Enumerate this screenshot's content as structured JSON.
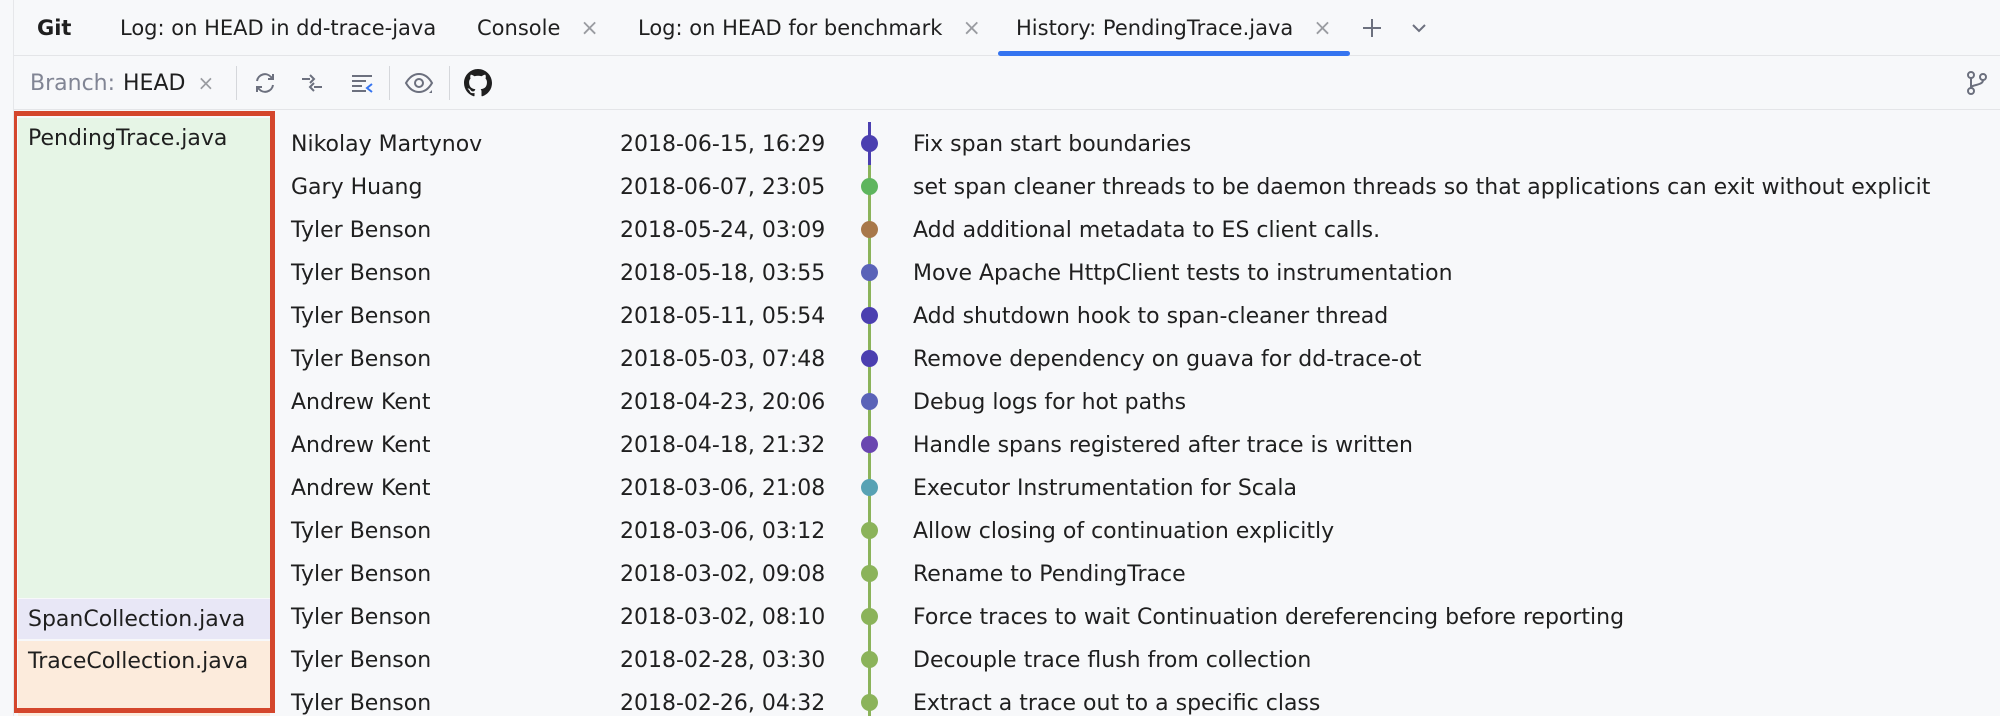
{
  "tabs": [
    {
      "label": "Git",
      "bold": true,
      "closable": false,
      "active": false
    },
    {
      "label": "Log: on HEAD in dd-trace-java",
      "closable": false,
      "active": false
    },
    {
      "label": "Console",
      "closable": true,
      "active": false
    },
    {
      "label": "Log: on HEAD for benchmark",
      "closable": true,
      "active": false
    },
    {
      "label": "History: PendingTrace.java",
      "closable": true,
      "active": true
    }
  ],
  "tab_close_glyph": "×",
  "toolbar": {
    "branch_label": "Branch:",
    "branch_value": "HEAD",
    "icons": [
      "refresh-icon",
      "collapse-icon",
      "align-icon",
      "eye-icon",
      "github-icon",
      "branch-icon"
    ]
  },
  "colors": {
    "accent": "#3574f0",
    "highlight_border": "#d4462c",
    "file_pending_bg": "#e6f5e6",
    "file_span_bg": "#e8e7f6",
    "file_trace_bg": "#fcebdc"
  },
  "files": {
    "pending": "PendingTrace.java",
    "span": "SpanCollection.java",
    "trace": "TraceCollection.java"
  },
  "commits": [
    {
      "author": "Nikolay Martynov",
      "date": "2018-06-15, 16:29",
      "message": "Fix span start boundaries",
      "dot_color": "#4b3fb0"
    },
    {
      "author": "Gary Huang",
      "date": "2018-06-07, 23:05",
      "message": "set span cleaner threads to be daemon threads so that applications can exit without explicit",
      "dot_color": "#5eb55e"
    },
    {
      "author": "Tyler Benson",
      "date": "2018-05-24, 03:09",
      "message": "Add additional metadata to ES client calls.",
      "dot_color": "#a8784a"
    },
    {
      "author": "Tyler Benson",
      "date": "2018-05-18, 03:55",
      "message": "Move Apache HttpClient tests to instrumentation",
      "dot_color": "#5a63b8"
    },
    {
      "author": "Tyler Benson",
      "date": "2018-05-11, 05:54",
      "message": "Add shutdown hook to span-cleaner thread",
      "dot_color": "#4b3fb0"
    },
    {
      "author": "Tyler Benson",
      "date": "2018-05-03, 07:48",
      "message": "Remove dependency on guava for dd-trace-ot",
      "dot_color": "#4b3fb0"
    },
    {
      "author": "Andrew Kent",
      "date": "2018-04-23, 20:06",
      "message": "Debug logs for hot paths",
      "dot_color": "#5a63b8"
    },
    {
      "author": "Andrew Kent",
      "date": "2018-04-18, 21:32",
      "message": "Handle spans registered after trace is written",
      "dot_color": "#6a46b0"
    },
    {
      "author": "Andrew Kent",
      "date": "2018-03-06, 21:08",
      "message": "Executor Instrumentation for Scala",
      "dot_color": "#58a2b4"
    },
    {
      "author": "Tyler Benson",
      "date": "2018-03-06, 03:12",
      "message": "Allow closing of continuation explicitly",
      "dot_color": "#8bb35a"
    },
    {
      "author": "Tyler Benson",
      "date": "2018-03-02, 09:08",
      "message": "Rename to PendingTrace",
      "dot_color": "#8bb35a"
    },
    {
      "author": "Tyler Benson",
      "date": "2018-03-02, 08:10",
      "message": "Force traces to wait Continuation dereferencing before reporting",
      "dot_color": "#8bb35a"
    },
    {
      "author": "Tyler Benson",
      "date": "2018-02-28, 03:30",
      "message": "Decouple trace flush from collection",
      "dot_color": "#8bb35a"
    },
    {
      "author": "Tyler Benson",
      "date": "2018-02-26, 04:32",
      "message": "Extract a trace out to a specific class",
      "dot_color": "#8bb35a"
    }
  ]
}
